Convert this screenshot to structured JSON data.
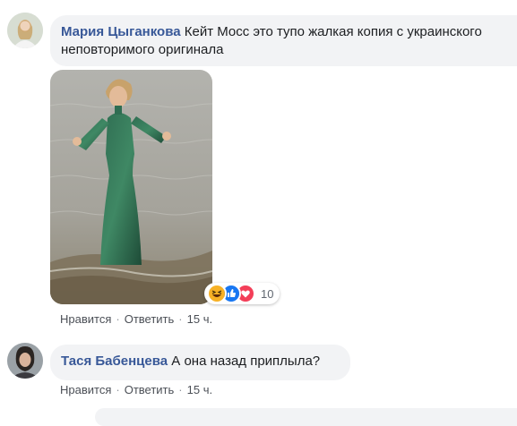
{
  "comments": [
    {
      "author": "Мария Цыганкова",
      "text": "Кейт Мосс это тупо жалкая копия с украинского неповторимого оригинала",
      "actions": {
        "like": "Нравится",
        "reply": "Ответить",
        "time": "15 ч."
      },
      "reactions": {
        "icons": [
          "haha-icon",
          "like-icon",
          "love-icon"
        ],
        "count": "10"
      }
    },
    {
      "author": "Тася Бабенцева",
      "text": "А она назад приплыла?",
      "actions": {
        "like": "Нравится",
        "reply": "Ответить",
        "time": "15 ч."
      }
    }
  ],
  "separator": "·",
  "colors": {
    "author": "#385898",
    "bubble": "#f2f3f5",
    "meta": "#606770",
    "like_blue": "#1877f2",
    "love_red": "#f33e58",
    "haha_yellow": "#f7b125"
  }
}
